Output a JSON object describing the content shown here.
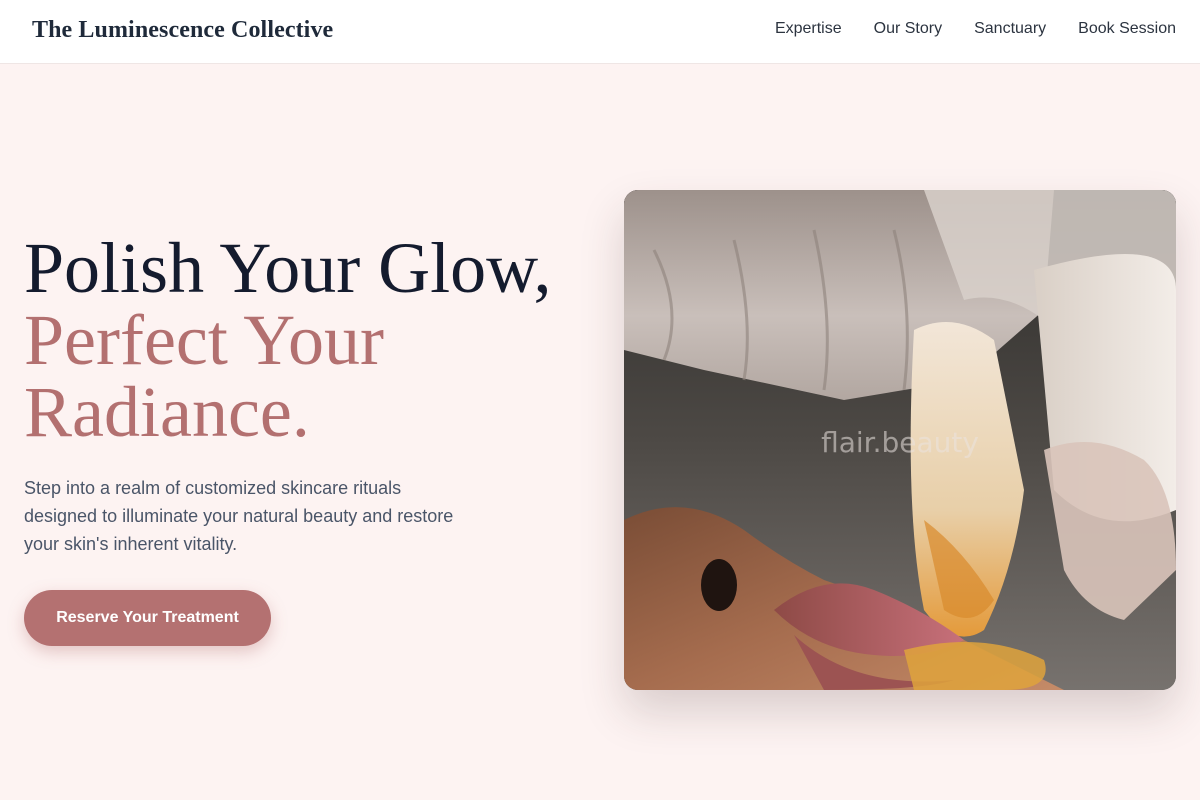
{
  "header": {
    "brand": "The Luminescence Collective",
    "nav": [
      "Expertise",
      "Our Story",
      "Sanctuary",
      "Book Session"
    ]
  },
  "hero": {
    "title_line1": "Polish Your Glow,",
    "title_line2": "Perfect Your",
    "title_line3": "Radiance.",
    "description": "Step into a realm of customized skincare rituals designed to illuminate your natural beauty and restore your skin's inherent vitality.",
    "cta_label": "Reserve Your Treatment",
    "image_watermark": "flair.beauty"
  },
  "colors": {
    "background": "#fdf3f2",
    "accent": "#b47171",
    "heading_dark": "#141b2e"
  }
}
